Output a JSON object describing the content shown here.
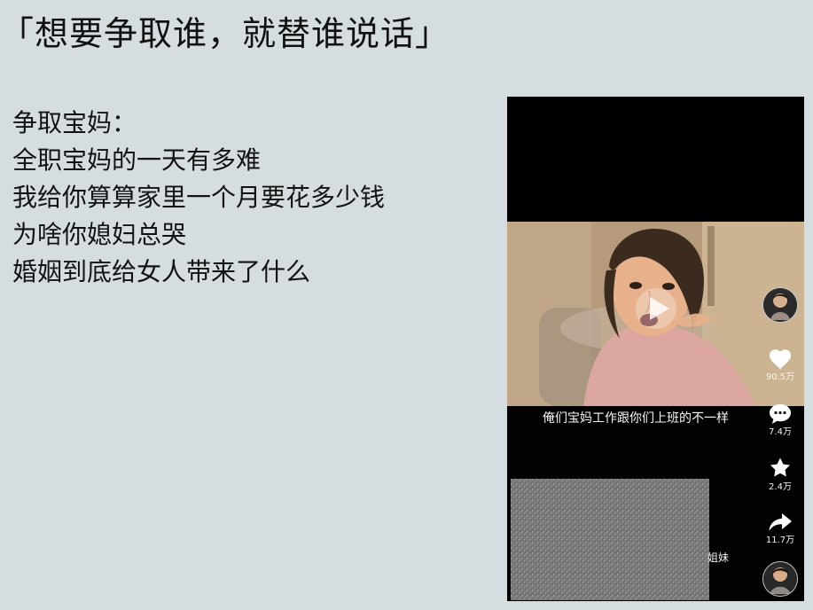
{
  "slide": {
    "title": "「想要争取谁，就替谁说话」",
    "section_label": "争取宝妈：",
    "bullets": [
      "全职宝妈的一天有多难",
      "我给你算算家里一个月要花多少钱",
      "为啥你媳妇总哭",
      "婚姻到底给女人带来了什么"
    ]
  },
  "phone": {
    "video_caption": "俺们宝妈工作跟你们上班的不一样",
    "side_actions": {
      "likes": "90.5万",
      "comments": "7.4万",
      "favorites": "2.4万",
      "shares": "11.7万"
    },
    "bottom_name": "姐妹",
    "icons": {
      "avatar_top": "avatar",
      "play": "play-icon",
      "heart": "heart-icon",
      "comment": "comment-icon",
      "star": "star-icon",
      "share": "share-icon",
      "avatar_bottom": "avatar"
    }
  },
  "colors": {
    "slide_background": "#d6dde1",
    "text": "#121212",
    "phone_background": "#020202",
    "caption_text": "#f5f5f5"
  }
}
